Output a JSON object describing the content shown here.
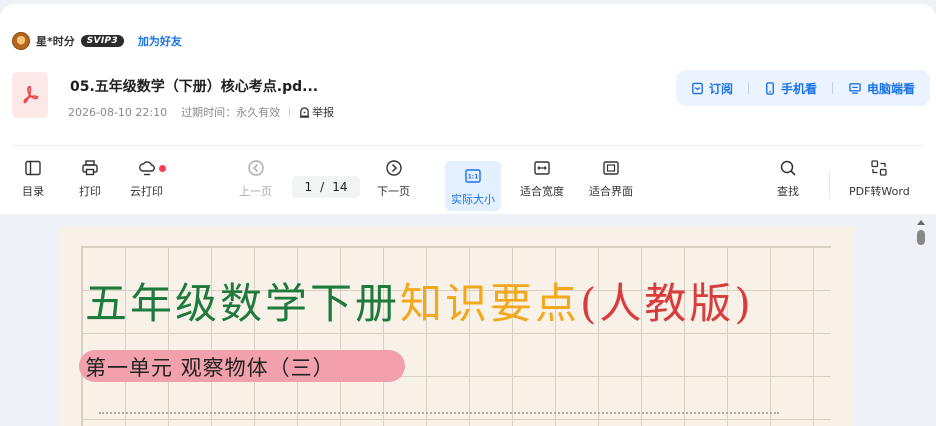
{
  "user": {
    "name": "星*时分",
    "vip": "SVIP3",
    "add_friend": "加为好友"
  },
  "document": {
    "title": "05.五年级数学（下册）核心考点.pd...",
    "date": "2026-08-10 22:10",
    "expiry_label": "过期时间：",
    "expiry_value": "永久有效",
    "report": "举报"
  },
  "actions": {
    "subscribe": "订阅",
    "mobile": "手机看",
    "desktop": "电脑端看"
  },
  "toolbar": {
    "toc": "目录",
    "print": "打印",
    "cloud_print": "云打印",
    "prev_page": "上一页",
    "current_page": "1",
    "page_separator": "/",
    "total_pages": "14",
    "next_page": "下一页",
    "actual_size": "实际大小",
    "actual_size_icon_text": "1:1",
    "fit_width": "适合宽度",
    "fit_page": "适合界面",
    "find": "查找",
    "pdf_to_word": "PDF转Word"
  },
  "page_content": {
    "title_part1": "五年级数学下册",
    "title_part2": "知识要点",
    "title_part3": "(人教版)",
    "unit_heading": "第一单元 观察物体（三）"
  },
  "colors": {
    "accent": "#1a73e8",
    "title_green": "#1f7a3e",
    "title_orange": "#f2a81d",
    "title_red": "#d93c3c",
    "banner_pink": "#f2a0ab"
  },
  "icons": [
    "toc-icon",
    "printer-icon",
    "cloud-print-icon",
    "prev-page-icon",
    "next-page-icon",
    "actual-size-icon",
    "fit-width-icon",
    "fit-page-icon",
    "search-icon",
    "pdf-to-word-icon"
  ]
}
